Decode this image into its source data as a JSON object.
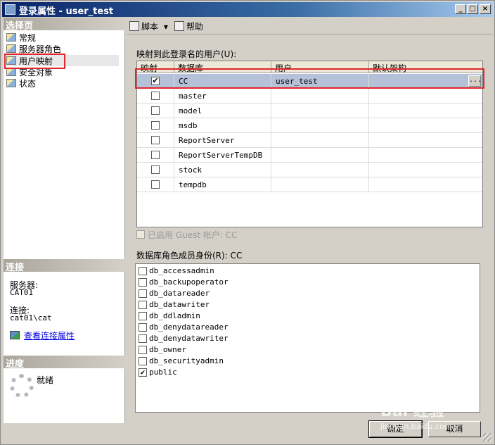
{
  "window": {
    "title": "登录属性 - user_test",
    "minimize": "_",
    "maximize": "□",
    "close": "×"
  },
  "left": {
    "select_page_header": "选择页",
    "nav_items": [
      "常规",
      "服务器角色",
      "用户映射",
      "安全对象",
      "状态"
    ],
    "selected_index": 2,
    "connection_header": "连接",
    "server_label": "服务器:",
    "server_value": "CAT01",
    "connection_label": "连接:",
    "connection_value": "cat01\\cat",
    "view_connection_link": "查看连接属性",
    "progress_header": "进度",
    "progress_status": "就绪"
  },
  "toolbar": {
    "script_label": "脚本",
    "dropdown_arrow": "▾",
    "help_label": "帮助"
  },
  "mapping": {
    "label": "映射到此登录名的用户(U):",
    "columns": [
      "映射",
      "数据库",
      "用户",
      "默认架构"
    ],
    "rows": [
      {
        "checked": true,
        "database": "CC",
        "user": "user_test",
        "schema": "",
        "ellipsis": "..."
      },
      {
        "checked": false,
        "database": "master",
        "user": "",
        "schema": ""
      },
      {
        "checked": false,
        "database": "model",
        "user": "",
        "schema": ""
      },
      {
        "checked": false,
        "database": "msdb",
        "user": "",
        "schema": ""
      },
      {
        "checked": false,
        "database": "ReportServer",
        "user": "",
        "schema": ""
      },
      {
        "checked": false,
        "database": "ReportServerTempDB",
        "user": "",
        "schema": ""
      },
      {
        "checked": false,
        "database": "stock",
        "user": "",
        "schema": ""
      },
      {
        "checked": false,
        "database": "tempdb",
        "user": "",
        "schema": ""
      }
    ]
  },
  "guest": {
    "label": "已启用 Guest 帐户: CC"
  },
  "roles": {
    "label": "数据库角色成员身份(R): CC",
    "items": [
      {
        "name": "db_accessadmin",
        "checked": false
      },
      {
        "name": "db_backupoperator",
        "checked": false
      },
      {
        "name": "db_datareader",
        "checked": false
      },
      {
        "name": "db_datawriter",
        "checked": false
      },
      {
        "name": "db_ddladmin",
        "checked": false
      },
      {
        "name": "db_denydatareader",
        "checked": false
      },
      {
        "name": "db_denydatawriter",
        "checked": false
      },
      {
        "name": "db_owner",
        "checked": false
      },
      {
        "name": "db_securityadmin",
        "checked": false
      },
      {
        "name": "public",
        "checked": true
      }
    ]
  },
  "footer": {
    "ok_label": "确定",
    "cancel_label": "取消"
  },
  "watermark": {
    "brand": "Bai 经验",
    "url": "jingyan.baidu.com"
  },
  "colors": {
    "title_bar": "#0a246a",
    "highlight_border": "#e2252b",
    "selected_row": "#b4c1d8",
    "link": "#0000e0"
  }
}
